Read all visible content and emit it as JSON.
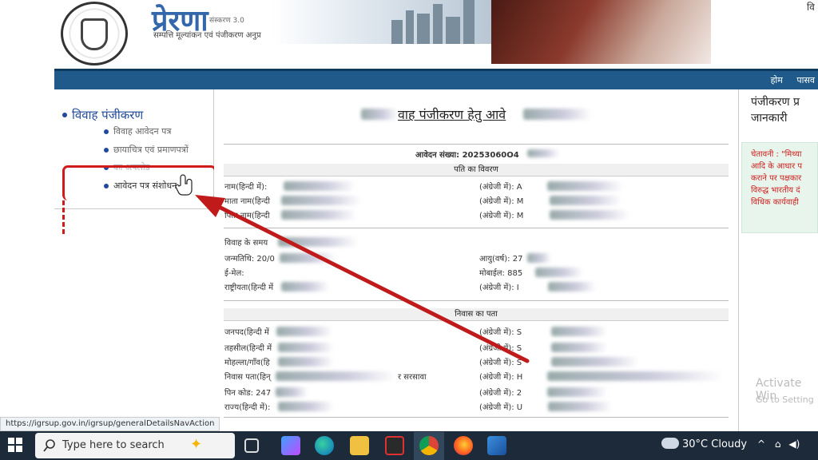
{
  "header": {
    "brand": "प्रेरणा",
    "version": "संस्करण 3.0",
    "tagline": "सम्पत्ति मूल्यांकन एवं पंजीकरण अनुप्र",
    "right_text": "वि"
  },
  "nav": {
    "items": [
      "होम",
      "पासव"
    ]
  },
  "sidebar": {
    "heading": "विवाह पंजीकरण",
    "items": [
      {
        "label": "विवाह आवेदन पत्र"
      },
      {
        "label": "छायाचित्र एवं प्रमाणपत्रों"
      },
      {
        "label": "का अपलोड"
      },
      {
        "label": "आवेदन पत्र संशोधन"
      }
    ]
  },
  "main": {
    "title": "वाह पंजीकरण हेतु आवे",
    "application_no": "आवेदन संख्या: 20253060O4",
    "section_husband": "पति का विवरण",
    "section_address": "निवास का पता",
    "fields_left": [
      "नाम(हिन्दी में):",
      "माता नाम(हिन्दी",
      "पिता नाम(हिन्दी"
    ],
    "fields_right": [
      "(अंग्रेजी में): A",
      "(अंग्रेजी में): M",
      "(अंग्रेजी में): M"
    ],
    "marriage_time": "विवाह के समय",
    "dob": "जन्मतिथि: 20/0",
    "age": "आयु(वर्ष): 27",
    "email": "ई-मेल:",
    "mobile": "मोबाईल: 885",
    "nationality": "राष्ट्रीयता(हिन्दी में",
    "nationality_en": "(अंग्रेजी में): I",
    "addr_left": [
      "जनपद(हिन्दी में",
      "तहसील(हिन्दी में",
      "मोहल्ला/गाँव(हि",
      "निवास पता(हिन्",
      "पिन कोड: 247",
      "राज्य(हिन्दी में):"
    ],
    "addr_right": [
      "(अंग्रेजी में): S",
      "(अंग्रेजी में): S",
      "(अंग्रेजी में): S",
      "(अंग्रेजी में): H",
      "(अंग्रेजी में): 2",
      "(अंग्रेजी में): U"
    ],
    "addr_extra": "र सरसावा"
  },
  "right_panel": {
    "title_line1": "पंजीकरण प्र",
    "title_line2": "जानकारी",
    "warning": "चेतावनी : \"मिथ्या\nआदि के आधार प\nकराने पर पक्षकार\nविरुद्ध भारतीय दं\nविधिक कार्यवाही"
  },
  "watermark": {
    "line1": "Activate Win",
    "line2": "Go to Setting"
  },
  "status_url": "https://igrsup.gov.in/igrsup/generalDetailsNavAction",
  "taskbar": {
    "search_placeholder": "Type here to search",
    "weather": "30°C  Cloudy"
  },
  "colors": {
    "nav": "#1f5a8a",
    "highlight": "#d01b1b",
    "arrow": "#c01a1a"
  }
}
